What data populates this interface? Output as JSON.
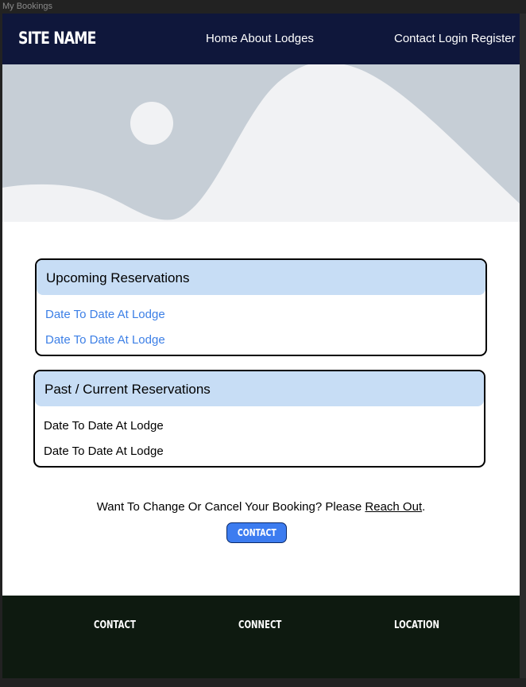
{
  "window": {
    "title": "My Bookings"
  },
  "nav": {
    "site_name": "SITE NAME",
    "links_center": "Home About Lodges",
    "links_right": "Contact Login Register"
  },
  "hero": {
    "icon": "image-placeholder-icon"
  },
  "upcoming": {
    "title": "Upcoming Reservations",
    "items": [
      "Date To Date At Lodge",
      "Date To Date At Lodge"
    ]
  },
  "past": {
    "title": "Past / Current Reservations",
    "items": [
      "Date To Date At Lodge",
      "Date To Date At Lodge"
    ]
  },
  "change": {
    "text_before": "Want To Change Or Cancel Your Booking? Please ",
    "link": "Reach Out",
    "text_after": ".",
    "button": "CONTACT"
  },
  "footer": {
    "col1": "CONTACT",
    "col2": "CONNECT",
    "col3": "LOCATION"
  },
  "colors": {
    "nav_bg": "#0f173b",
    "card_header": "#c7ddf5",
    "link_blue": "#3c7fe6",
    "button_blue": "#3c7cf0",
    "footer_bg": "#0e1a10"
  }
}
